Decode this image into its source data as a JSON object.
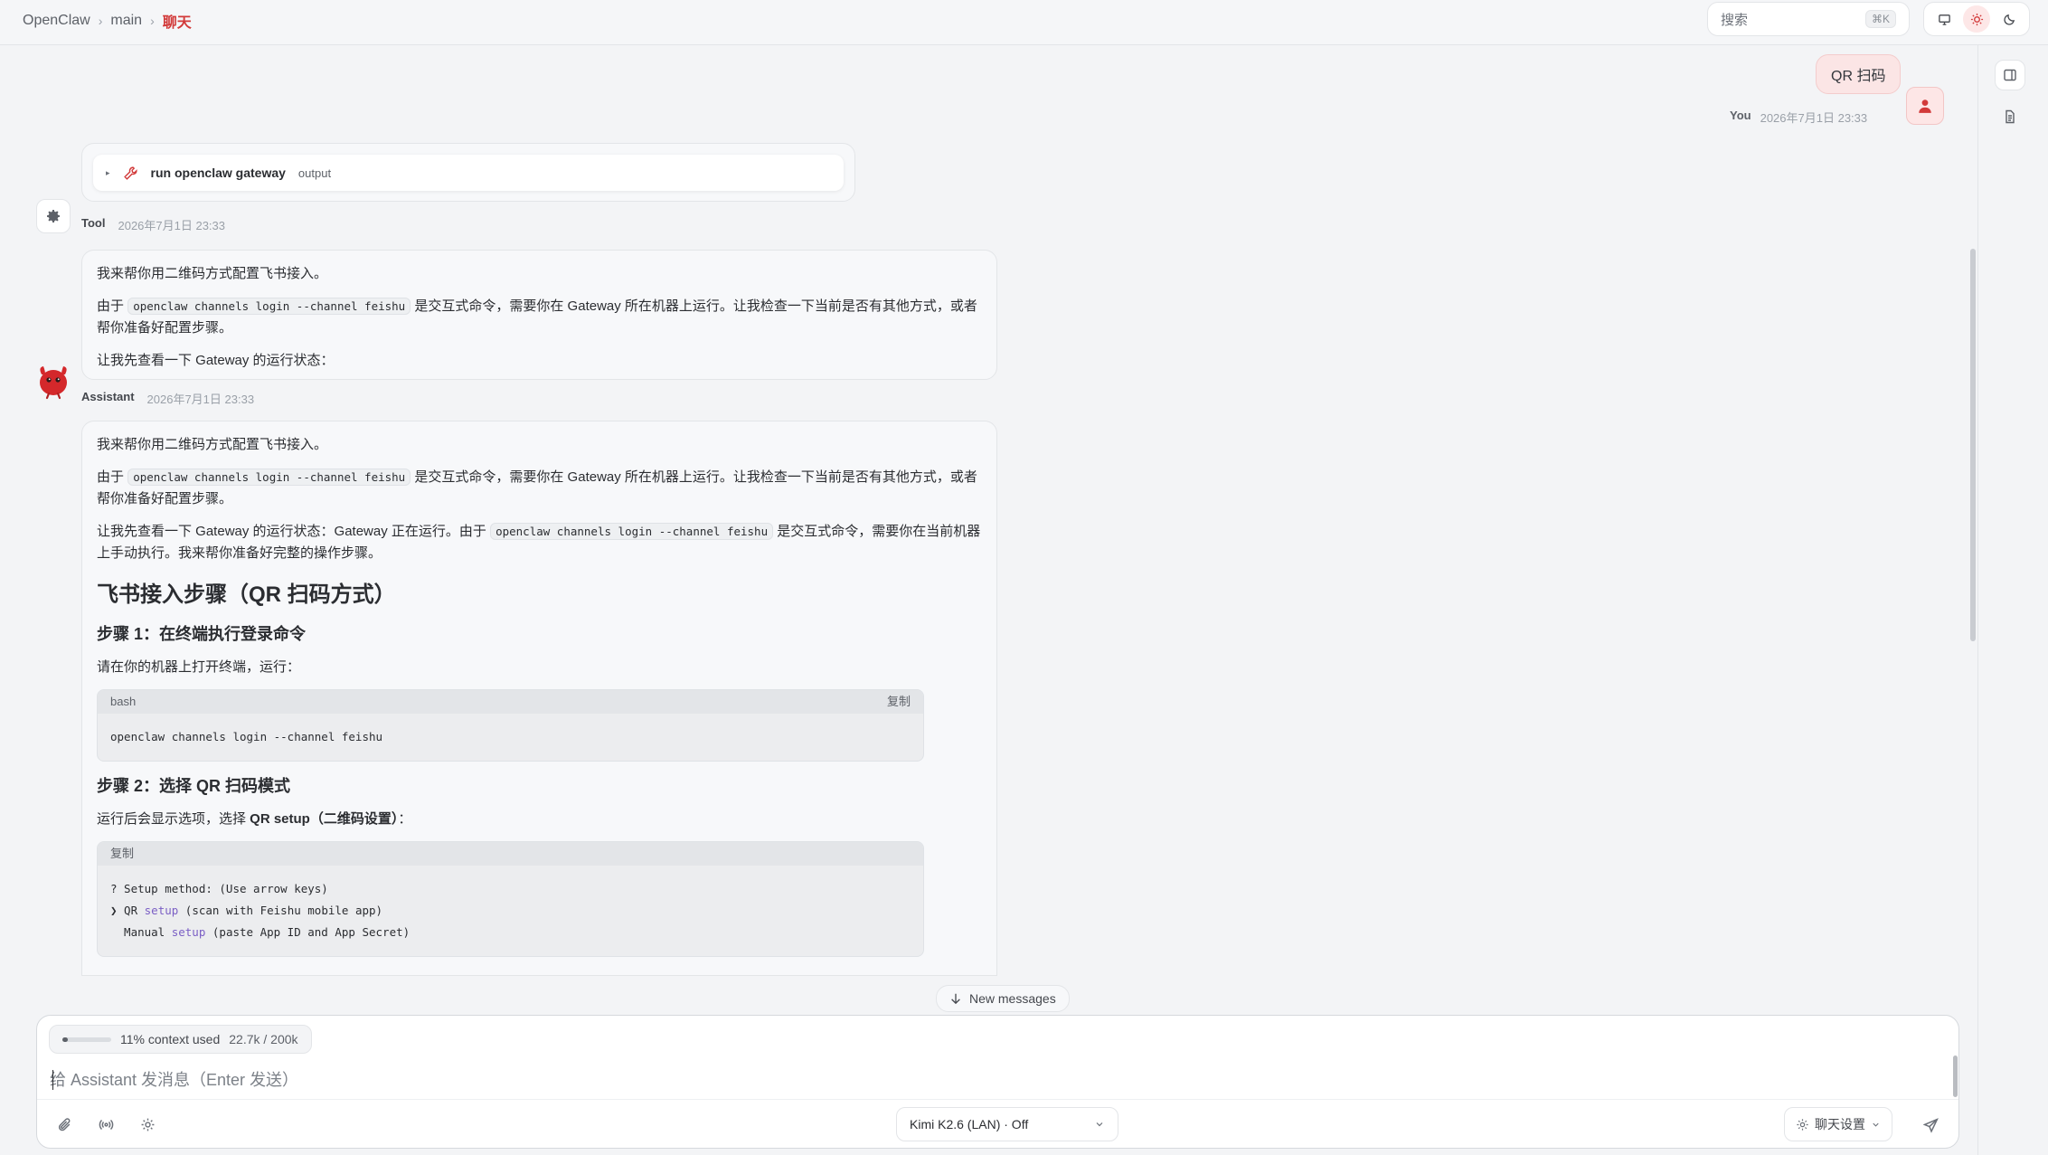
{
  "breadcrumb": {
    "root": "OpenClaw",
    "branch": "main",
    "current": "聊天"
  },
  "search": {
    "placeholder": "搜索",
    "shortcut": "⌘K"
  },
  "theme": {
    "options": [
      "monitor-icon",
      "sun-icon",
      "moon-icon"
    ],
    "active": "sun-icon",
    "accent": "#d23a3a"
  },
  "right_rail": {
    "icons": [
      "sidebar-toggle-icon",
      "document-icon"
    ]
  },
  "user_message": {
    "text": "QR 扫码",
    "author": "You",
    "time": "2026年7月1日 23:33"
  },
  "tool_message": {
    "name": "run openclaw gateway",
    "output_label": "output",
    "author": "Tool",
    "time": "2026年7月1日 23:33"
  },
  "assistant_message_1": {
    "p1": "我来帮你用二维码方式配置飞书接入。",
    "p2_before": "由于",
    "p2_code": "openclaw channels login --channel feishu",
    "p2_after": "是交互式命令，需要你在 Gateway 所在机器上运行。让我检查一下当前是否有其他方式，或者帮你准备好配置步骤。",
    "p3": "让我先查看一下 Gateway 的运行状态：",
    "author": "Assistant",
    "time": "2026年7月1日 23:33"
  },
  "assistant_message_2": {
    "p1": "我来帮你用二维码方式配置飞书接入。",
    "p2_before": "由于",
    "p2_code": "openclaw channels login --channel feishu",
    "p2_after": "是交互式命令，需要你在 Gateway 所在机器上运行。让我检查一下当前是否有其他方式，或者帮你准备好配置步骤。",
    "p3_before": "让我先查看一下 Gateway 的运行状态：Gateway 正在运行。由于",
    "p3_code": "openclaw channels login --channel feishu",
    "p3_after": "是交互式命令，需要你在当前机器上手动执行。我来帮你准备好完整的操作步骤。",
    "h2": "飞书接入步骤（QR 扫码方式）",
    "step1_title": "步骤 1：在终端执行登录命令",
    "step1_text": "请在你的机器上打开终端，运行：",
    "code1_lang": "bash",
    "code1_copy": "复制",
    "code1_body": "openclaw channels login --channel feishu",
    "step2_title": "步骤 2：选择 QR 扫码模式",
    "step2_text_before": "运行后会显示选项，选择 ",
    "step2_bold": "QR setup（二维码设置）",
    "step2_text_after": "：",
    "code2_copy": "复制",
    "code2_line1": "? Setup method: (Use arrow keys)",
    "code2_line2_a": "❯ QR ",
    "code2_line2_kw": "setup",
    "code2_line2_b": " (scan with Feishu mobile app)",
    "code2_line3_a": "  Manual ",
    "code2_line3_kw": "setup",
    "code2_line3_b": " (paste App ID and App Secret)"
  },
  "new_messages": {
    "label": "New messages"
  },
  "composer": {
    "context_percent": 0.11,
    "context_label": "11% context used",
    "tokens": "22.7k / 200k",
    "placeholder": "给 Assistant 发消息（Enter 发送）",
    "model": "Kimi K2.6 (LAN) · Off",
    "settings_label": "聊天设置"
  }
}
